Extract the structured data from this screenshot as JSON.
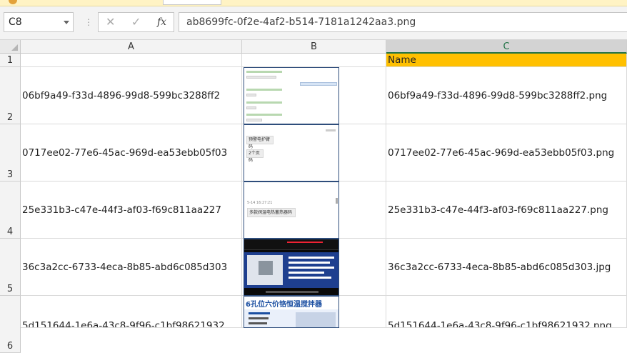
{
  "formula_bar": {
    "name_box": "C8",
    "formula": "ab8699fc-0f2e-4af2-b514-7181a1242aa3.png",
    "fx_label": "fx"
  },
  "columns": [
    "A",
    "B",
    "C"
  ],
  "rows": [
    {
      "num": "1",
      "a": "",
      "c": "Name"
    },
    {
      "num": "2",
      "a": "06bf9a49-f33d-4896-99d8-599bc3288ff2",
      "c": "06bf9a49-f33d-4896-99d8-599bc3288ff2.png"
    },
    {
      "num": "3",
      "a": "0717ee02-77e6-45ac-969d-ea53ebb05f03",
      "c": "0717ee02-77e6-45ac-969d-ea53ebb05f03.png"
    },
    {
      "num": "4",
      "a": "25e331b3-c47e-44f3-af03-f69c811aa227",
      "c": "25e331b3-c47e-44f3-af03-f69c811aa227.png"
    },
    {
      "num": "5",
      "a": "36c3a2cc-6733-4eca-8b85-abd6c085d303",
      "c": "36c3a2cc-6733-4eca-8b85-abd6c085d303.jpg"
    },
    {
      "num": "6",
      "a": "5d151644-1e6a-43c8-9f96-c1bf98621932",
      "c": "5d151644-1e6a-43c8-9f96-c1bf98621932.png"
    }
  ],
  "thumbnails": {
    "t2_line1": "预警电护臂码",
    "t2_line2": "2个页码",
    "t3_time": "5-14 16:27:21",
    "t3_msg": "多款阀温电热蓄热器码",
    "t5_title": "6孔位六价铬恒温搅拌器"
  },
  "colors": {
    "header_fill": "#ffc000",
    "selected_col": "#217346"
  }
}
